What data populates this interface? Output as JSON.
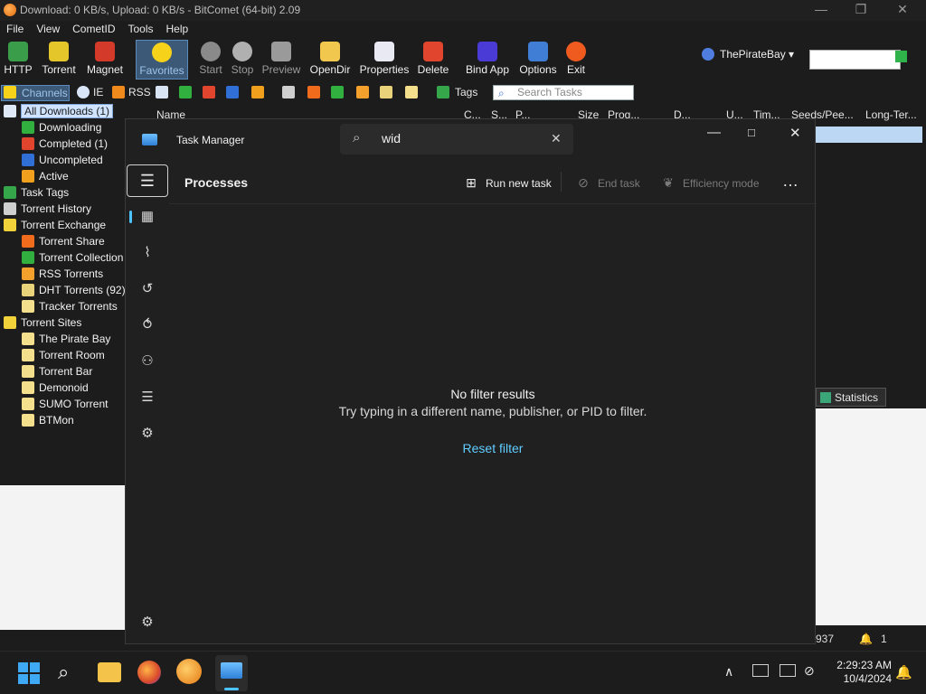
{
  "bitcomet": {
    "title": "Download: 0 KB/s, Upload: 0 KB/s - BitComet (64-bit) 2.09",
    "menu": [
      "File",
      "View",
      "CometID",
      "Tools",
      "Help"
    ],
    "toolbar": [
      {
        "label": "HTTP",
        "icon": "http-icon"
      },
      {
        "label": "Torrent",
        "icon": "torrent-icon"
      },
      {
        "label": "Magnet",
        "icon": "magnet-icon"
      },
      {
        "label": "Favorites",
        "icon": "favorites-star-icon"
      },
      {
        "label": "Start",
        "icon": "start-icon"
      },
      {
        "label": "Stop",
        "icon": "stop-icon"
      },
      {
        "label": "Preview",
        "icon": "preview-icon"
      },
      {
        "label": "OpenDir",
        "icon": "opendir-icon"
      },
      {
        "label": "Properties",
        "icon": "properties-icon"
      },
      {
        "label": "Delete",
        "icon": "delete-icon"
      },
      {
        "label": "Bind App",
        "icon": "bind-app-icon"
      },
      {
        "label": "Options",
        "icon": "options-icon"
      },
      {
        "label": "Exit",
        "icon": "exit-icon"
      }
    ],
    "site_selector": "ThePirateBay",
    "toolbar2": {
      "channels": "Channels",
      "ie": "IE",
      "rss": "RSS",
      "tags": "Tags",
      "search_placeholder": "Search Tasks"
    },
    "tree": [
      {
        "label": "All Downloads (1)",
        "selected": true
      },
      {
        "label": "Downloading"
      },
      {
        "label": "Completed (1)"
      },
      {
        "label": "Uncompleted"
      },
      {
        "label": "Active"
      },
      {
        "label": "Task Tags"
      },
      {
        "label": "Torrent History"
      },
      {
        "label": "Torrent Exchange"
      },
      {
        "label": "Torrent Share"
      },
      {
        "label": "Torrent Collection"
      },
      {
        "label": "RSS Torrents"
      },
      {
        "label": "DHT Torrents (92)"
      },
      {
        "label": "Tracker Torrents"
      },
      {
        "label": "Torrent Sites"
      },
      {
        "label": "The Pirate Bay"
      },
      {
        "label": "Torrent Room"
      },
      {
        "label": "Torrent Bar"
      },
      {
        "label": "Demonoid"
      },
      {
        "label": "SUMO Torrent"
      },
      {
        "label": "BTMon"
      }
    ],
    "columns": [
      "Name",
      "C...",
      "S...",
      "P...",
      "Size",
      "Prog...",
      "D...",
      "U...",
      "Tim...",
      "Seeds/Pee...",
      "Long-Ter..."
    ],
    "statistics_tab": "Statistics",
    "status": {
      "left": "937",
      "right": "1"
    }
  },
  "task_manager": {
    "title": "Task Manager",
    "search_value": "wid",
    "page_title": "Processes",
    "commands": {
      "run_new_task": "Run new task",
      "end_task": "End task",
      "efficiency_mode": "Efficiency mode"
    },
    "empty": {
      "heading": "No filter results",
      "hint": "Try typing in a different name, publisher, or PID to filter.",
      "reset": "Reset filter"
    }
  },
  "taskbar": {
    "time": "2:29:23 AM",
    "date": "10/4/2024"
  },
  "colors": {
    "accent": "#4cc2ff",
    "link": "#60cdff",
    "selection": "#cfe3ff"
  }
}
